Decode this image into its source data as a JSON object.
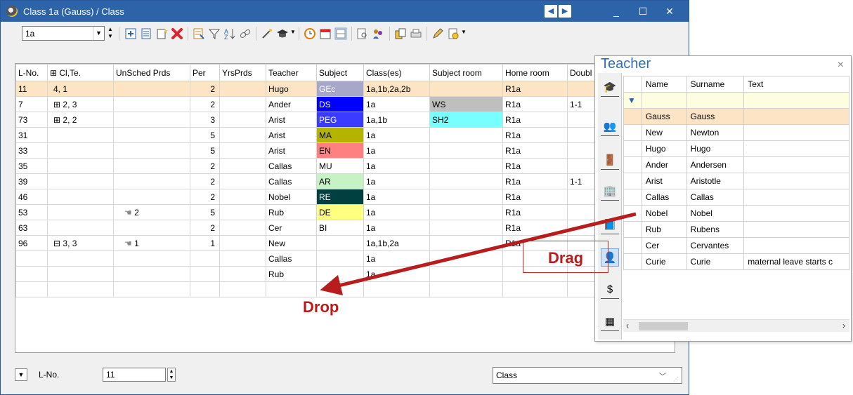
{
  "window": {
    "title": "Class 1a (Gauss) / Class",
    "minimize": "_",
    "maximize": "☐",
    "close": "✕",
    "nav_prev": "◀",
    "nav_next": "▶"
  },
  "toolbar": {
    "class_value": "1a"
  },
  "grid": {
    "columns": [
      "L-No.",
      "⊞ Cl,Te.",
      "UnSched Prds",
      "Per",
      "YrsPrds",
      "Teacher",
      "Subject",
      "Class(es)",
      "Subject room",
      "Home room",
      "Doubl"
    ],
    "rows": [
      {
        "lno": "11",
        "clte": "4, 1",
        "unsched": "",
        "per": "2",
        "yrs": "",
        "teacher": "Hugo",
        "subject": "GEc",
        "subject_color": "#a7a7c9",
        "subject_text_color": "#ffffff",
        "classes": "1a,1b,2a,2b",
        "subject_room": "",
        "subject_room_color": "",
        "home_room": "R1a",
        "double": "",
        "selected": true
      },
      {
        "lno": "7",
        "clte": "⊞ 2, 3",
        "unsched": "",
        "per": "2",
        "yrs": "",
        "teacher": "Ander",
        "subject": "DS",
        "subject_color": "#0000ff",
        "subject_text_color": "#ffffff",
        "classes": "1a",
        "subject_room": "WS",
        "subject_room_color": "#bfbfbf",
        "home_room": "R1a",
        "double": "1-1"
      },
      {
        "lno": "73",
        "clte": "⊞ 2, 2",
        "unsched": "",
        "per": "3",
        "yrs": "",
        "teacher": "Arist",
        "subject": "PEG",
        "subject_color": "#3b3bff",
        "subject_text_color": "#ffffff",
        "classes": "1a,1b",
        "subject_room": "SH2",
        "subject_room_color": "#77ffff",
        "home_room": "R1a",
        "double": ""
      },
      {
        "lno": "31",
        "clte": "",
        "unsched": "",
        "per": "5",
        "yrs": "",
        "teacher": "Arist",
        "subject": "MA",
        "subject_color": "#b4b400",
        "subject_text_color": "#000000",
        "classes": "1a",
        "subject_room": "",
        "subject_room_color": "",
        "home_room": "R1a",
        "double": ""
      },
      {
        "lno": "33",
        "clte": "",
        "unsched": "",
        "per": "5",
        "yrs": "",
        "teacher": "Arist",
        "subject": "EN",
        "subject_color": "#ff8080",
        "subject_text_color": "#000000",
        "classes": "1a",
        "subject_room": "",
        "subject_room_color": "",
        "home_room": "R1a",
        "double": ""
      },
      {
        "lno": "35",
        "clte": "",
        "unsched": "",
        "per": "2",
        "yrs": "",
        "teacher": "Callas",
        "subject": "MU",
        "subject_color": "#ffffff",
        "subject_text_color": "#000000",
        "classes": "1a",
        "subject_room": "",
        "subject_room_color": "",
        "home_room": "R1a",
        "double": ""
      },
      {
        "lno": "39",
        "clte": "",
        "unsched": "",
        "per": "2",
        "yrs": "",
        "teacher": "Callas",
        "subject": "AR",
        "subject_color": "#c6f2c6",
        "subject_text_color": "#000000",
        "classes": "1a",
        "subject_room": "",
        "subject_room_color": "",
        "home_room": "R1a",
        "double": "1-1"
      },
      {
        "lno": "46",
        "clte": "",
        "unsched": "",
        "per": "2",
        "yrs": "",
        "teacher": "Nobel",
        "subject": "RE",
        "subject_color": "#004040",
        "subject_text_color": "#ffffff",
        "classes": "1a",
        "subject_room": "",
        "subject_room_color": "",
        "home_room": "R1a",
        "double": ""
      },
      {
        "lno": "53",
        "clte": "",
        "unsched": "2",
        "unsched_icon": true,
        "per": "5",
        "yrs": "",
        "teacher": "Rub",
        "subject": "DE",
        "subject_color": "#ffff80",
        "subject_text_color": "#000000",
        "classes": "1a",
        "subject_room": "",
        "subject_room_color": "",
        "home_room": "R1a",
        "double": ""
      },
      {
        "lno": "63",
        "clte": "",
        "unsched": "",
        "per": "2",
        "yrs": "",
        "teacher": "Cer",
        "subject": "BI",
        "subject_color": "#ffffff",
        "subject_text_color": "#000000",
        "classes": "1a",
        "subject_room": "",
        "subject_room_color": "",
        "home_room": "R1a",
        "double": ""
      },
      {
        "lno": "96",
        "clte": "⊟ 3, 3",
        "unsched": "1",
        "unsched_icon": true,
        "per": "1",
        "yrs": "",
        "teacher": "New",
        "subject": "",
        "subject_color": "#ffffff",
        "subject_text_color": "#000000",
        "classes": "1a,1b,2a",
        "subject_room": "",
        "subject_room_color": "",
        "home_room": "R1a",
        "double": ""
      },
      {
        "lno": "",
        "clte": "",
        "unsched": "",
        "per": "",
        "yrs": "",
        "teacher": "Callas",
        "subject": "",
        "subject_color": "#ffffff",
        "subject_text_color": "#000000",
        "classes": "1a",
        "subject_room": "",
        "subject_room_color": "",
        "home_room": "",
        "double": ""
      },
      {
        "lno": "",
        "clte": "",
        "unsched": "",
        "per": "",
        "yrs": "",
        "teacher": "Rub",
        "subject": "",
        "subject_color": "#ffffff",
        "subject_text_color": "#000000",
        "classes": "1a",
        "subject_room": "",
        "subject_room_color": "",
        "home_room": "",
        "double": ""
      },
      {
        "lno": "",
        "clte": "",
        "unsched": "",
        "per": "",
        "yrs": "",
        "teacher": "",
        "subject": "",
        "subject_color": "#ffffff",
        "subject_text_color": "#000000",
        "classes": "",
        "subject_room": "",
        "subject_room_color": "",
        "home_room": "",
        "double": ""
      }
    ]
  },
  "bottom": {
    "lno_label": "L-No.",
    "lno_value": "11",
    "view_value": "Class"
  },
  "teacher_panel": {
    "title": "Teacher",
    "close": "×",
    "columns": [
      "Name",
      "Surname",
      "Text"
    ],
    "rows": [
      {
        "name": "Gauss",
        "surname": "Gauss",
        "text": "",
        "highlight": true
      },
      {
        "name": "New",
        "surname": "Newton",
        "text": ""
      },
      {
        "name": "Hugo",
        "surname": "Hugo",
        "text": ""
      },
      {
        "name": "Ander",
        "surname": "Andersen",
        "text": ""
      },
      {
        "name": "Arist",
        "surname": "Aristotle",
        "text": ""
      },
      {
        "name": "Callas",
        "surname": "Callas",
        "text": ""
      },
      {
        "name": "Nobel",
        "surname": "Nobel",
        "text": ""
      },
      {
        "name": "Rub",
        "surname": "Rubens",
        "text": ""
      },
      {
        "name": "Cer",
        "surname": "Cervantes",
        "text": ""
      },
      {
        "name": "Curie",
        "surname": "Curie",
        "text": "maternal leave starts c"
      }
    ]
  },
  "annotations": {
    "drag": "Drag",
    "drop": "Drop",
    "color": "#b91c1c"
  }
}
